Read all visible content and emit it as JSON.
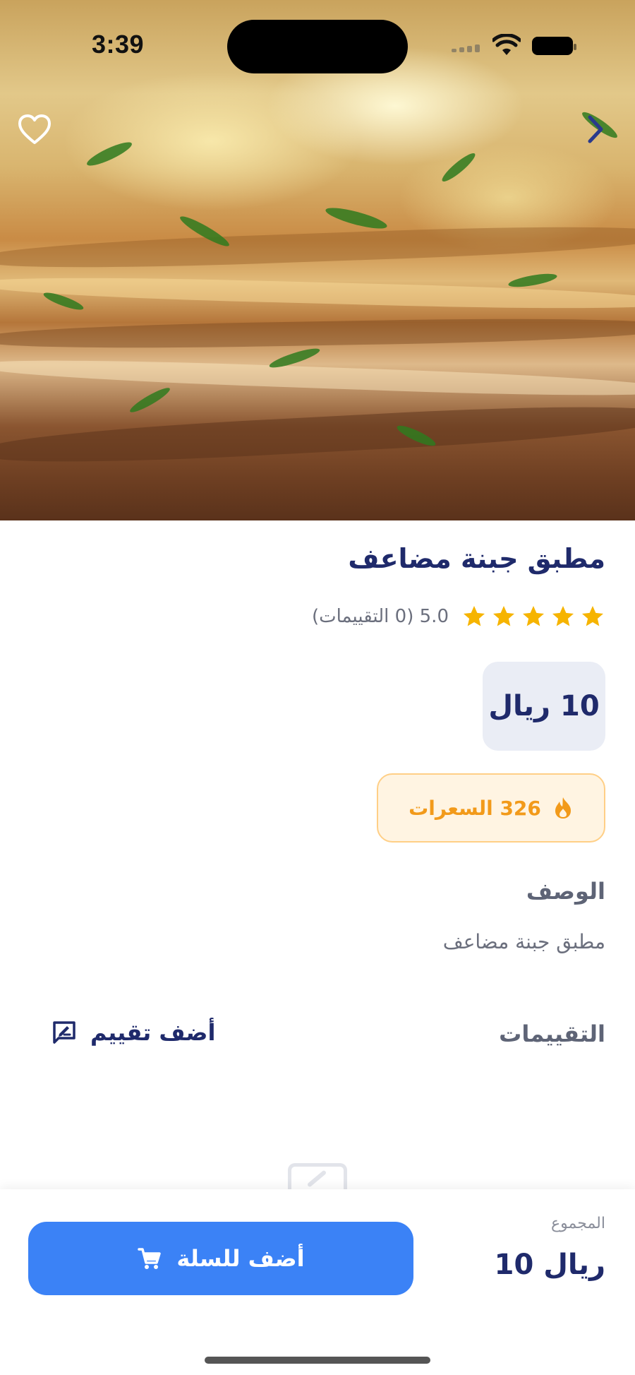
{
  "status_bar": {
    "time": "3:39"
  },
  "product": {
    "name": "مطبق جبنة مضاعف",
    "rating_stars": 5,
    "rating_text": "5.0 (0 التقييمات)",
    "price": "10 ريال",
    "calories": "326 السعرات"
  },
  "description": {
    "heading": "الوصف",
    "text": "مطبق جبنة مضاعف"
  },
  "reviews": {
    "heading": "التقييمات",
    "add_label": "أضف تقييم"
  },
  "bottom_bar": {
    "total_label": "المجموع",
    "total_value": "10 ريال",
    "cart_button_label": "أضف للسلة"
  },
  "icons": {
    "favorite": "heart-outline-icon",
    "back": "chevron-right-icon",
    "star": "star-icon",
    "calories": "flame-icon",
    "add_review": "rate-review-icon",
    "cart": "cart-icon"
  },
  "colors": {
    "primary_text": "#1f2a6b",
    "accent_blue": "#3b82f6",
    "star": "#f6b400",
    "calorie_orange": "#f29a1a",
    "calorie_bg": "#fff4e2",
    "price_bg": "#eaedf5"
  }
}
